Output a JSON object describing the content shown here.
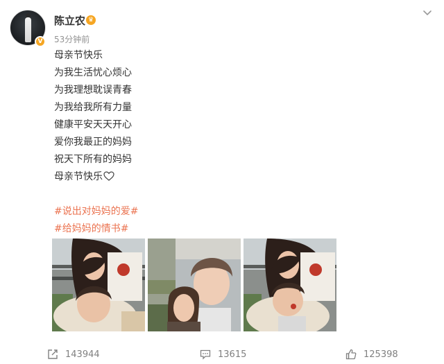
{
  "post": {
    "author": {
      "name": "陈立农",
      "avatar_icon": "avatar",
      "verified_icon": "verified-badge-icon",
      "vip_icon": "vip-crown-icon"
    },
    "timestamp": "53分钟前",
    "lines": [
      "母亲节快乐",
      "为我生活忧心烦心",
      "为我理想耽误青春",
      "为我给我所有力量",
      "健康平安天天开心",
      "爱你我最正的妈妈",
      "祝天下所有的妈妈",
      "母亲节快乐"
    ],
    "hashtags": [
      "#说出对妈妈的爱#",
      "#给妈妈的情书#"
    ],
    "accent_color": "#eb7350",
    "images": [
      "selfie-photo-1",
      "selfie-photo-2",
      "selfie-photo-3"
    ]
  },
  "footer": {
    "repost_count": "143944",
    "comment_count": "13615",
    "like_count": "125398"
  }
}
